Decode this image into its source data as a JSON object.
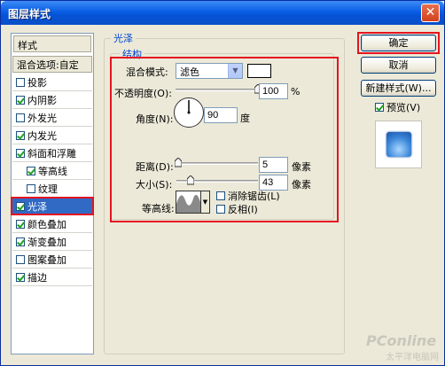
{
  "window": {
    "title": "图层样式",
    "close_glyph": "✕"
  },
  "sidebar": {
    "header": "样式",
    "blend_options": "混合选项:自定",
    "items": [
      {
        "label": "投影",
        "checked": false
      },
      {
        "label": "内阴影",
        "checked": true
      },
      {
        "label": "外发光",
        "checked": false
      },
      {
        "label": "内发光",
        "checked": true
      },
      {
        "label": "斜面和浮雕",
        "checked": true
      },
      {
        "label": "等高线",
        "checked": true,
        "indent": true
      },
      {
        "label": "纹理",
        "checked": false,
        "indent": true
      },
      {
        "label": "光泽",
        "checked": true,
        "selected": true
      },
      {
        "label": "颜色叠加",
        "checked": true
      },
      {
        "label": "渐变叠加",
        "checked": true
      },
      {
        "label": "图案叠加",
        "checked": false
      },
      {
        "label": "描边",
        "checked": true
      }
    ]
  },
  "panel": {
    "title": "光泽",
    "structure_title": "结构",
    "blend_mode_label": "混合模式:",
    "blend_mode_value": "滤色",
    "blend_color": "#ffffff",
    "opacity_label": "不透明度(O):",
    "opacity_value": "100",
    "opacity_unit": "%",
    "angle_label": "角度(N):",
    "angle_value": "90",
    "angle_unit": "度",
    "distance_label": "距离(D):",
    "distance_value": "5",
    "distance_unit": "像素",
    "size_label": "大小(S):",
    "size_value": "43",
    "size_unit": "像素",
    "contour_label": "等高线:",
    "antialias_label": "消除锯齿(L)",
    "antialias_checked": false,
    "invert_label": "反相(I)",
    "invert_checked": false
  },
  "buttons": {
    "ok": "确定",
    "cancel": "取消",
    "new_style": "新建样式(W)...",
    "preview_label": "预览(V)",
    "preview_checked": true
  },
  "watermark": {
    "brand": "PConline",
    "sub": "太平洋电脑网"
  },
  "colors": {
    "accent": "#316ac5",
    "highlight_red": "#e41420",
    "group_title": "#0046d5"
  }
}
